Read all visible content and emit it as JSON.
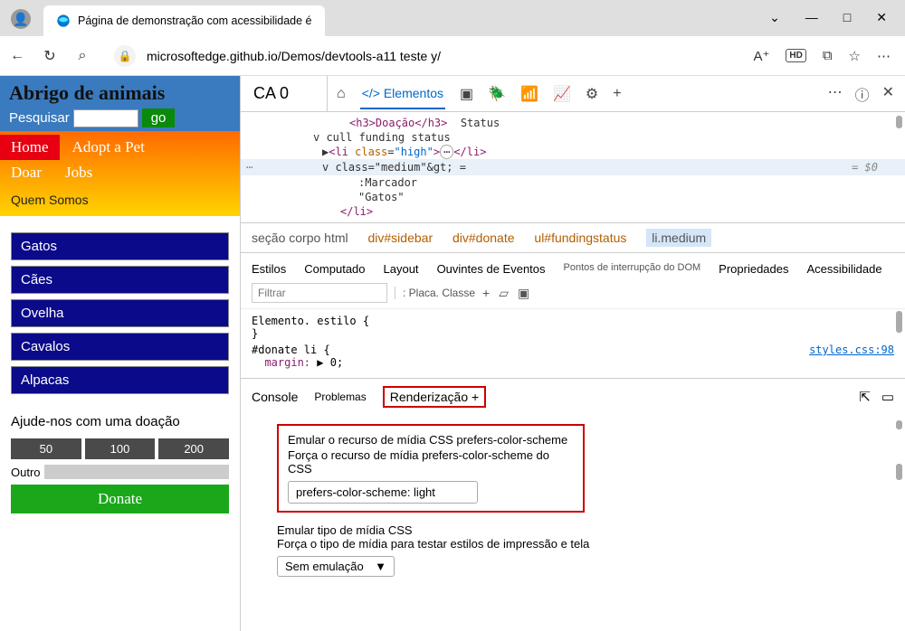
{
  "tab_title": "Página de demonstração com acessibilidade é",
  "url": "microsoftedge.github.io/Demos/devtools-a11 teste y/",
  "win": {
    "min": "—",
    "max": "□",
    "close": "✕",
    "chev": "⌄"
  },
  "toolbar": {
    "read": "A⁺",
    "hd": "HD",
    "book": "📖",
    "star": "☆",
    "more": "⋯"
  },
  "page": {
    "title": "Abrigo de animais",
    "search_label": "Pesquisar",
    "go": "go",
    "nav": {
      "home": "Home",
      "adopt": "Adopt a Pet",
      "doar": "Doar",
      "jobs": "Jobs",
      "quem": "Quem Somos"
    },
    "cats": [
      "Gatos",
      "Cães",
      "Ovelha",
      "Cavalos",
      "Alpacas"
    ],
    "donate_h": "Ajude-nos com uma doação",
    "donate_vals": [
      "50",
      "100",
      "200"
    ],
    "outro": "Outro",
    "donate_btn": "Donate"
  },
  "dt": {
    "ca": "CA 0",
    "tabs": {
      "elements": "Elementos"
    },
    "more": "⋯",
    "help": "?",
    "close": "✕",
    "dom": {
      "h3": "<h3>Doação</h3>",
      "status": "Status",
      "cull": "v cull funding status",
      "li_high_open": "<li class=\"high\">",
      "ellipsis": "⋯",
      "li_close": "</li>",
      "med": "v class=\"medium\"&gt; =",
      "dollar": "= $0",
      "marker": ":Marcador",
      "gatos": "\"Gatos\"",
      "li_close2": "</li>"
    },
    "crumb": {
      "a": "seção corpo html",
      "b": "div#sidebar",
      "c": "div#donate",
      "d": "ul#fundingstatus",
      "e": "li.medium"
    },
    "stabs": {
      "estilos": "Estilos",
      "comp": "Computado",
      "layout": "Layout",
      "ouv": "Ouvintes de Eventos",
      "dom": "Pontos de interrupção do DOM",
      "prop": "Propriedades",
      "aces": "Acessibilidade"
    },
    "filter": "Filtrar",
    "placa": ": Placa. Classe",
    "plus": "+",
    "elstyle": "Elemento. estilo {",
    "brace": "}",
    "rule": "#donate li {",
    "margin": "margin:",
    "zero": "0;",
    "csslink": "styles.css:98",
    "drawer": {
      "console": "Console",
      "prob": "Problemas",
      "render": "Renderização +"
    },
    "panel": {
      "l1": "Emular o recurso de mídia CSS prefers-color-scheme",
      "l2": "Força o recurso de mídia prefers-color-scheme do CSS",
      "sel": "prefers-color-scheme: light",
      "l3": "Emular tipo de mídia CSS",
      "l4": "Força o tipo de mídia para testar estilos de impressão e tela",
      "sel2": "Sem emulação",
      "chev": "▼"
    }
  }
}
